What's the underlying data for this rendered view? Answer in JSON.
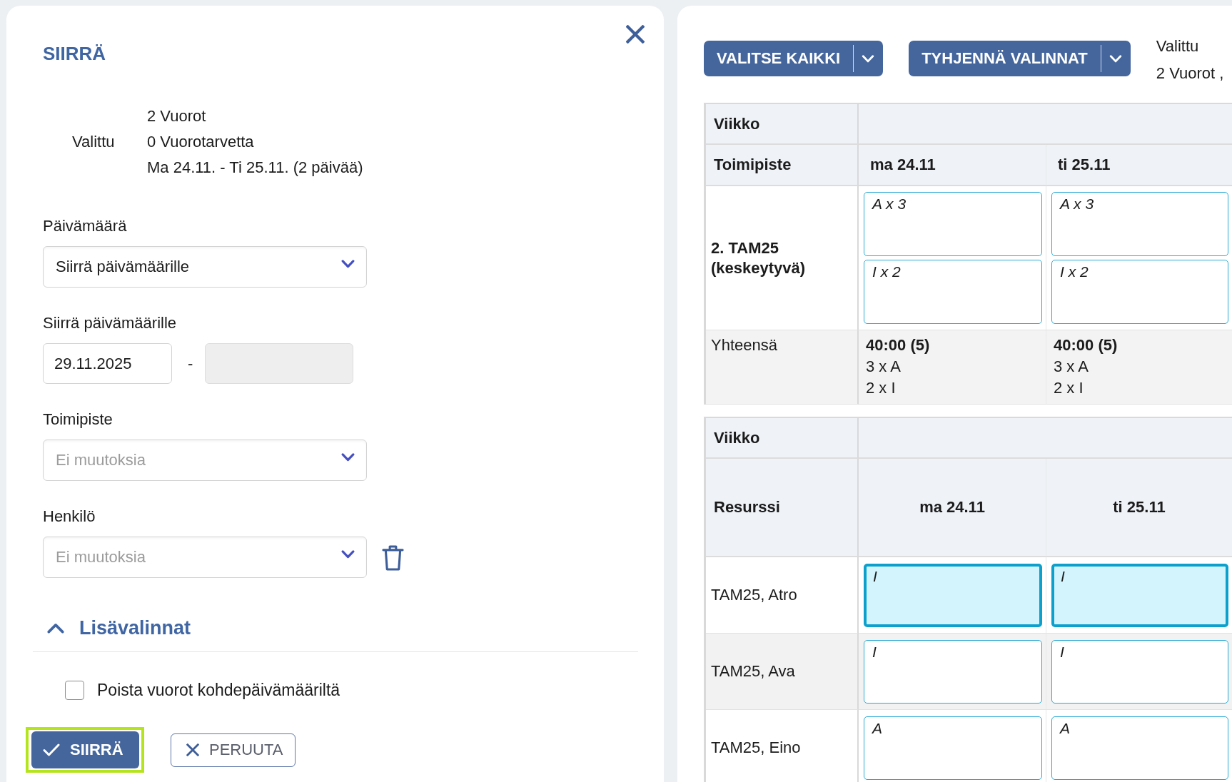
{
  "move_dialog": {
    "title": "SIIRRÄ",
    "summary": {
      "label": "Valittu",
      "lines": [
        "2 Vuorot",
        "0 Vuorotarvetta",
        "Ma 24.11. - Ti 25.11. (2 päivää)"
      ]
    },
    "fields": [
      {
        "kind": "select",
        "label": "Päivämäärä",
        "value": "Siirrä päivämäärille",
        "deletable": false
      },
      {
        "kind": "date_range",
        "label": "Siirrä päivämäärille",
        "start": {
          "value": "29.11.2025",
          "disabled": false
        },
        "separator": "-",
        "end": {
          "disabled": true
        }
      },
      {
        "kind": "select",
        "label": "Toimipiste",
        "placeholder": "Ei muutoksia",
        "deletable": false
      },
      {
        "kind": "select",
        "label": "Henkilö",
        "placeholder": "Ei muutoksia",
        "deletable": true
      }
    ],
    "advanced": {
      "label": "Lisävalinnat",
      "expanded": true,
      "options": [
        {
          "label": "Poista vuorot kohdepäivämääriltä",
          "checked": false
        }
      ]
    },
    "buttons": [
      {
        "kind": "primary",
        "label": "SIIRRÄ",
        "highlighted": true
      },
      {
        "kind": "secondary",
        "label": "PERUUTA",
        "highlighted": false
      }
    ]
  },
  "schedule": {
    "toolbar": {
      "buttons": [
        {
          "label": "VALITSE KAIKKI"
        },
        {
          "label": "TYHJENNÄ VALINNAT"
        }
      ],
      "selection": {
        "label": "Valittu",
        "value": "2 Vuorot ,"
      }
    },
    "tables": [
      {
        "kind": "location",
        "week_label": "Viikko",
        "row_header_title": "Toimipiste",
        "columns": [
          "ma 24.11",
          "ti 25.11"
        ],
        "rows": [
          {
            "label": "2. TAM25 (keskeytyvä)",
            "cells": [
              {
                "shifts": [
                  {
                    "text": "A x 3",
                    "selected": false
                  },
                  {
                    "text": "I x 2",
                    "selected": false
                  }
                ]
              },
              {
                "shifts": [
                  {
                    "text": "A x 3",
                    "selected": false
                  },
                  {
                    "text": "I x 2",
                    "selected": false
                  }
                ]
              }
            ]
          }
        ],
        "total": {
          "label": "Yhteensä",
          "cells": [
            {
              "hours": "40:00 (5)",
              "lines": [
                "3 x A",
                "2 x I"
              ]
            },
            {
              "hours": "40:00 (5)",
              "lines": [
                "3 x A",
                "2 x I"
              ]
            }
          ]
        }
      },
      {
        "kind": "resource",
        "week_label": "Viikko",
        "row_header_title": "Resurssi",
        "columns": [
          "ma 24.11",
          "ti 25.11"
        ],
        "rows": [
          {
            "label": "TAM25, Atro",
            "cells": [
              {
                "shifts": [
                  {
                    "text": "I",
                    "selected": true
                  }
                ]
              },
              {
                "shifts": [
                  {
                    "text": "I",
                    "selected": true
                  }
                ]
              }
            ]
          },
          {
            "label": "TAM25, Ava",
            "cells": [
              {
                "shifts": [
                  {
                    "text": "I",
                    "selected": false
                  }
                ]
              },
              {
                "shifts": [
                  {
                    "text": "I",
                    "selected": false
                  }
                ]
              }
            ]
          },
          {
            "label": "TAM25, Eino",
            "cells": [
              {
                "shifts": [
                  {
                    "text": "A",
                    "selected": false
                  }
                ]
              },
              {
                "shifts": [
                  {
                    "text": "A",
                    "selected": false
                  }
                ]
              }
            ]
          }
        ]
      }
    ]
  }
}
